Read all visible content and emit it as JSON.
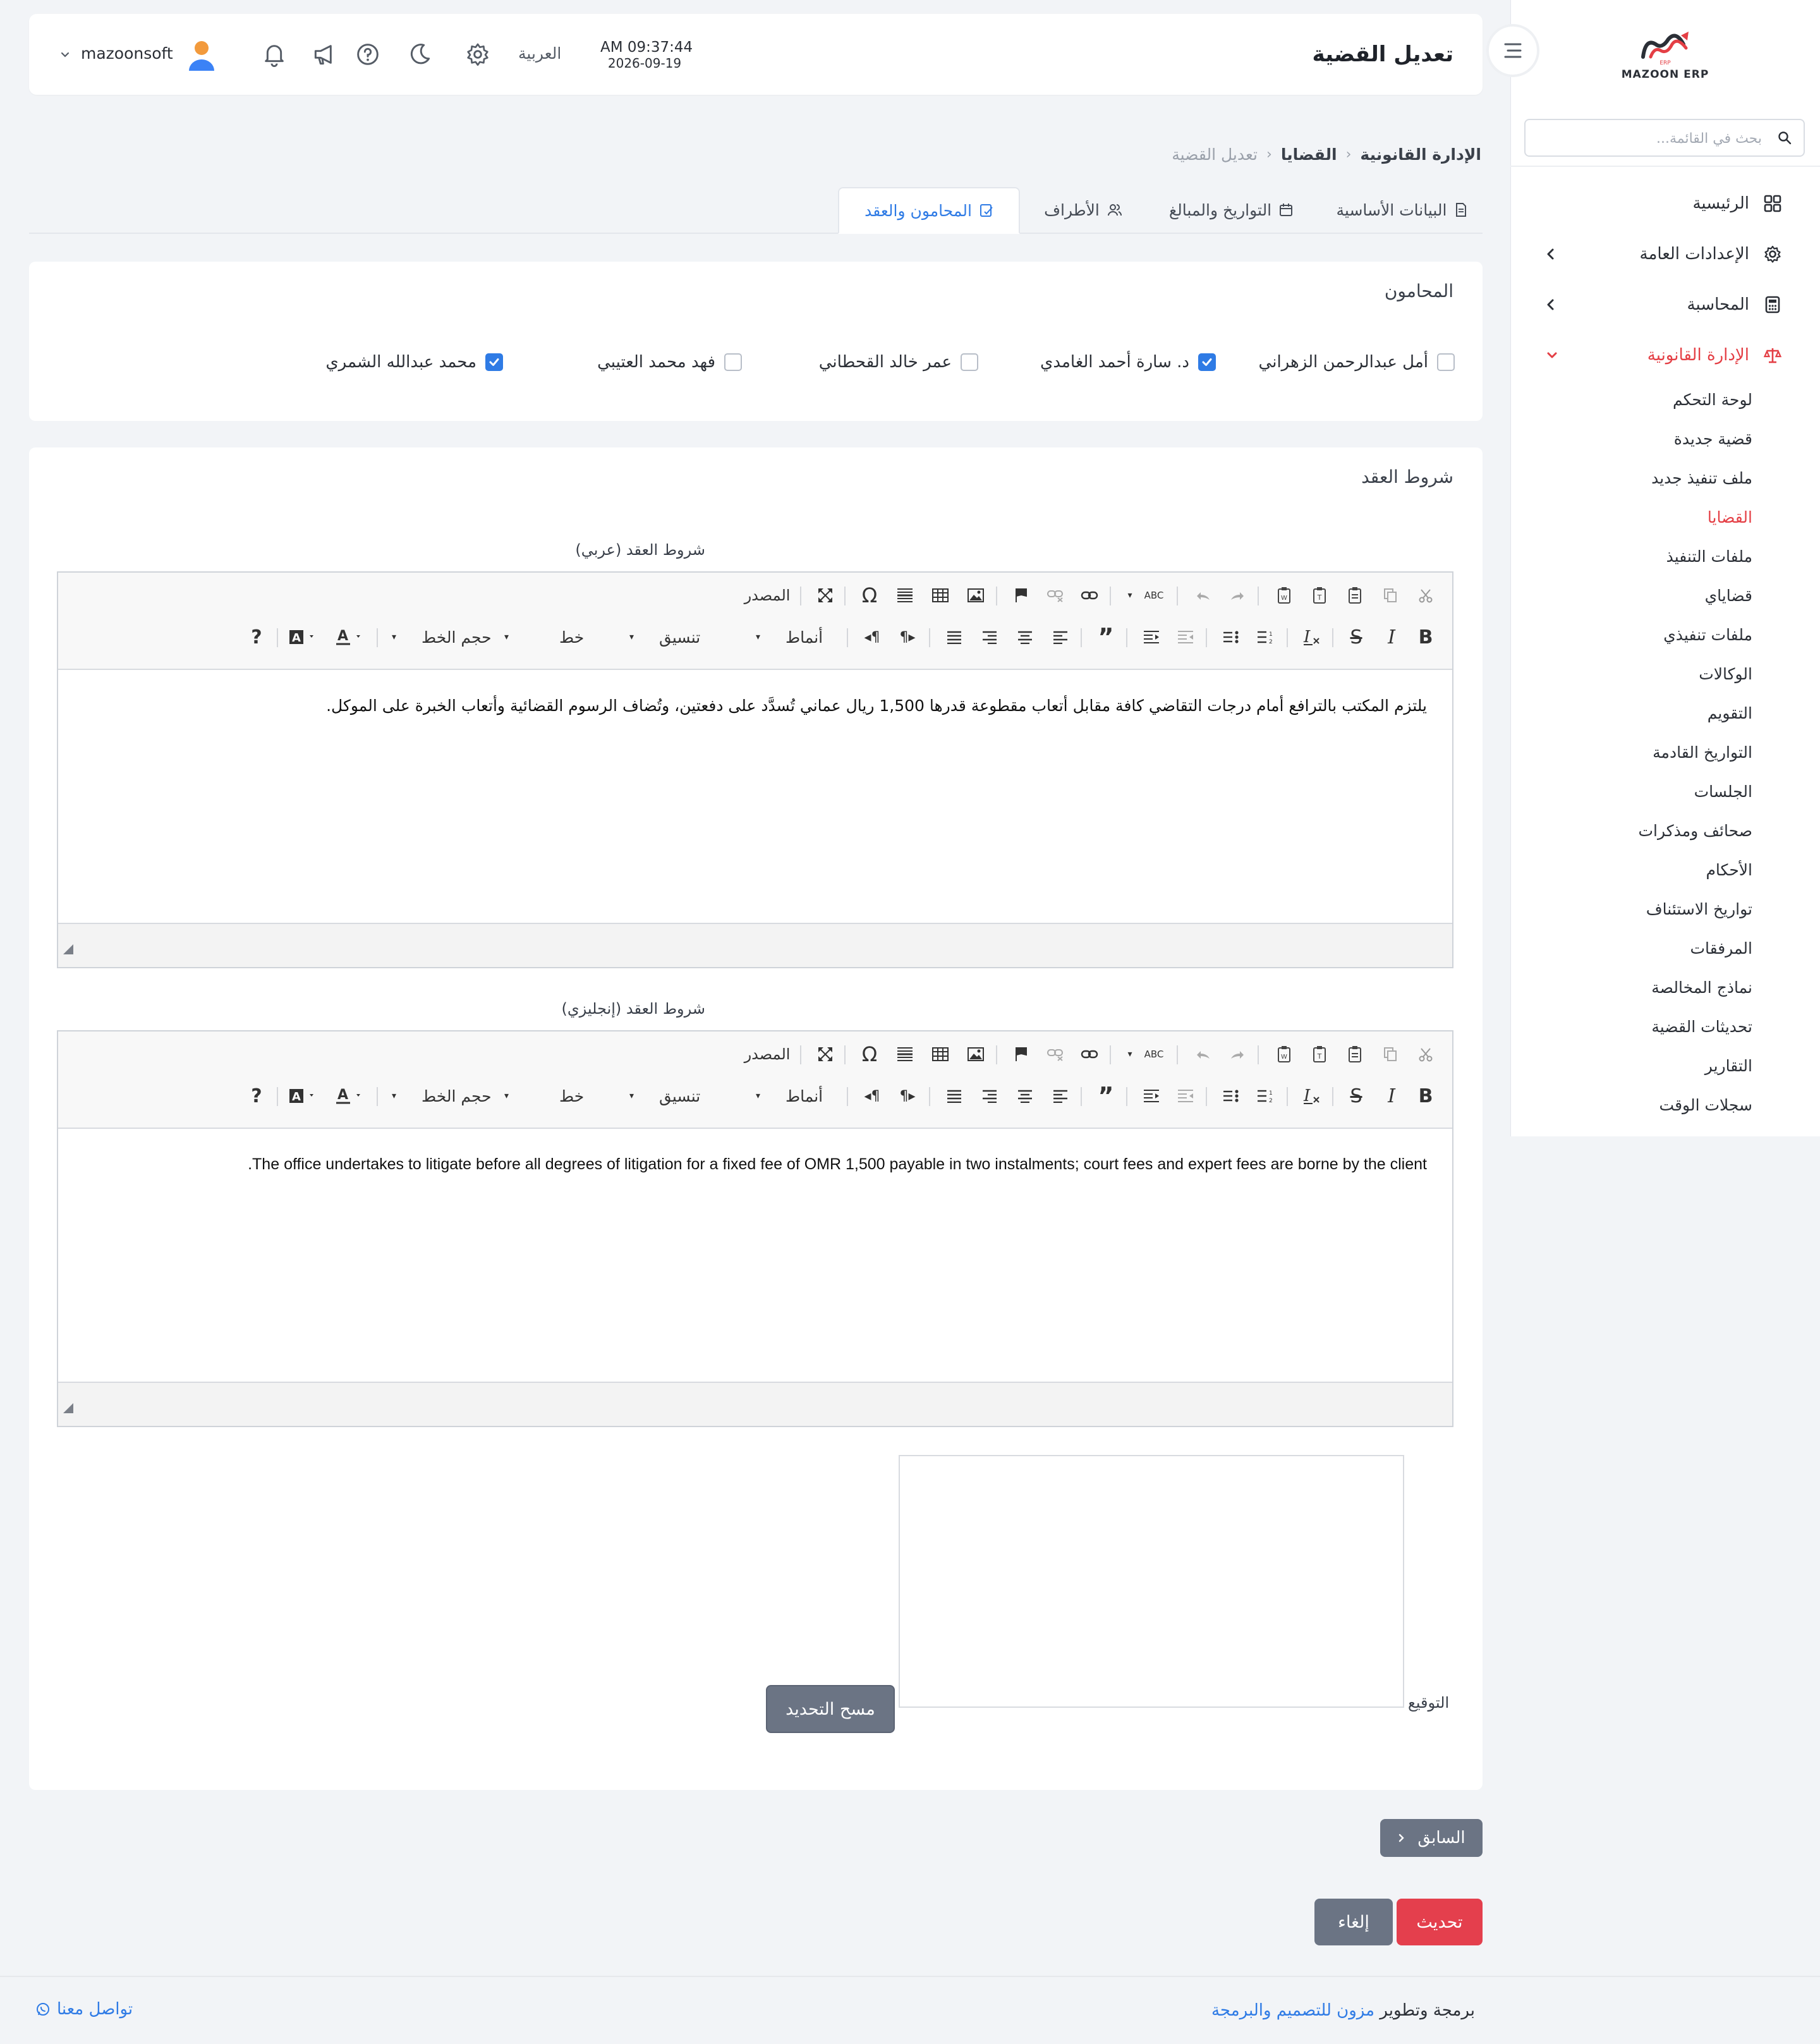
{
  "sidebar": {
    "logo_text": "MAZOON ERP",
    "logo_sub": "ERP",
    "search_placeholder": "بحث في القائمة...",
    "items": [
      {
        "label": "الرئيسية",
        "icon": "grid-icon"
      },
      {
        "label": "الإعدادات العامة",
        "icon": "gear-icon"
      },
      {
        "label": "المحاسبة",
        "icon": "calculator-icon"
      },
      {
        "label": "الإدارة القانونية",
        "icon": "scales-icon"
      }
    ],
    "sub_items": [
      {
        "label": "لوحة التحكم",
        "active": false
      },
      {
        "label": "قضية جديدة",
        "active": false
      },
      {
        "label": "ملف تنفيذ جديد",
        "active": false
      },
      {
        "label": "القضايا",
        "active": true
      },
      {
        "label": "ملفات التنفيذ",
        "active": false
      },
      {
        "label": "قضاياي",
        "active": false
      },
      {
        "label": "ملفات تنفيذي",
        "active": false
      },
      {
        "label": "الوكالات",
        "active": false
      },
      {
        "label": "التقويم",
        "active": false
      },
      {
        "label": "التواريخ القادمة",
        "active": false
      },
      {
        "label": "الجلسات",
        "active": false
      },
      {
        "label": "صحائف ومذكرات",
        "active": false
      },
      {
        "label": "الأحكام",
        "active": false
      },
      {
        "label": "تواريخ الاستئناف",
        "active": false
      },
      {
        "label": "المرفقات",
        "active": false
      },
      {
        "label": "نماذج المخالصة",
        "active": false
      },
      {
        "label": "تحديثات القضية",
        "active": false
      },
      {
        "label": "التقارير",
        "active": false
      },
      {
        "label": "سجلات الوقت",
        "active": false
      }
    ]
  },
  "header": {
    "title": "تعديل القضية",
    "time": "AM 09:37:44",
    "date": "2026-09-19",
    "language": "العربية",
    "user": "mazoonsoft"
  },
  "breadcrumb": {
    "root": "الإدارة القانونية",
    "parent": "القضايا",
    "current": "تعديل القضية"
  },
  "tabs": [
    {
      "label": "البيانات الأساسية",
      "icon": "document-icon"
    },
    {
      "label": "التواريخ والمبالغ",
      "icon": "calendar-icon"
    },
    {
      "label": "الأطراف",
      "icon": "users-icon"
    },
    {
      "label": "المحامون والعقد",
      "icon": "edit-doc-icon",
      "active": true
    }
  ],
  "lawyers": {
    "title": "المحامون",
    "options": [
      {
        "name": "أمل عبدالرحمن الزهراني",
        "checked": false
      },
      {
        "name": "د. سارة أحمد الغامدي",
        "checked": true
      },
      {
        "name": "عمر خالد القحطاني",
        "checked": false
      },
      {
        "name": "فهد محمد العتيبي",
        "checked": false
      },
      {
        "name": "محمد عبدالله الشمري",
        "checked": true
      }
    ]
  },
  "contract": {
    "title": "شروط العقد",
    "arabic_label": "شروط العقد (عربي)",
    "arabic_text": "يلتزم المكتب بالترافع أمام درجات التقاضي كافة مقابل أتعاب مقطوعة قدرها 1,500 ريال عماني تُسدَّد على دفعتين، وتُضاف الرسوم القضائية وأتعاب الخبرة على الموكل.",
    "english_label": "شروط العقد (إنجليزي)",
    "english_text": ".The office undertakes to litigate before all degrees of litigation for a fixed fee of OMR 1,500 payable in two instalments; court fees and expert fees are borne by the client",
    "signature_label": "التوقيع",
    "clear_signature": "مسح التحديد"
  },
  "editor_toolbar": {
    "source": "المصدر",
    "styles": "أنماط",
    "format": "تنسيق",
    "font": "خط",
    "size": "حجم الخط",
    "help": "?",
    "bold": "B",
    "italic": "I",
    "strike": "S",
    "spell": "ABC",
    "special_char": "Ω"
  },
  "actions": {
    "previous": "السابق",
    "update": "تحديث",
    "cancel": "إلغاء"
  },
  "footer": {
    "credit_prefix": "برمجة وتطوير",
    "credit_link": "مزون للتصميم والبرمجة",
    "contact": "تواصل معنا"
  },
  "colors": {
    "accent": "#2f7be5",
    "brand_red": "#e43f45",
    "button_gray": "#6b7484"
  }
}
